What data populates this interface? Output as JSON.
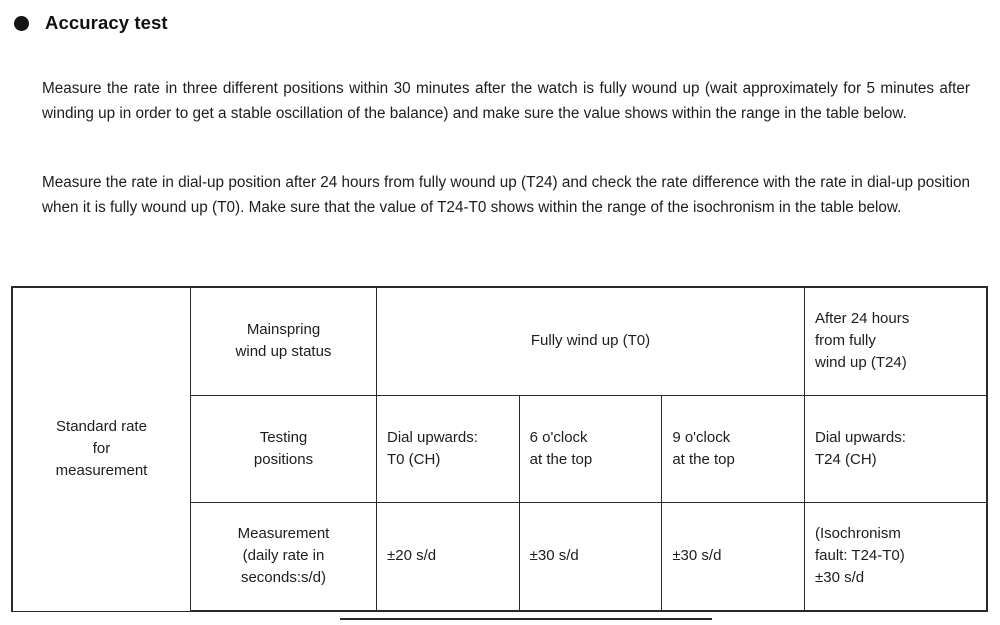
{
  "section": {
    "bullet_icon": "filled-circle-bullet",
    "heading": "Accuracy test"
  },
  "paragraphs": [
    "Measure the rate in three different positions within 30 minutes after the watch is fully wound up (wait approximately for 5 minutes after winding up in order to get a stable oscillation of the balance) and make sure the value shows within the range in the table below.",
    "Measure the rate in dial-up position after 24 hours from fully wound up (T24) and check the rate difference with the rate in dial-up position when it is fully wound up (T0).  Make sure that the value of T24-T0 shows within the range of the isochronism in the table below."
  ],
  "table": {
    "stub_label": "Standard rate\nfor\nmeasurement",
    "rows": [
      {
        "row_label": "Mainspring\nwind up status",
        "group_fully_wound": "Fully wind up (T0)",
        "group_after_24h": "After 24 hours\nfrom fully\nwind up (T24)"
      },
      {
        "row_label": "Testing\npositions",
        "cells": [
          "Dial upwards:\nT0 (CH)",
          "6 o'clock\nat the top",
          "9 o'clock\nat the top",
          "Dial upwards:\nT24 (CH)"
        ]
      },
      {
        "row_label": "Measurement\n(daily rate in\nseconds:s/d)",
        "cells": [
          "±20 s/d",
          "±30 s/d",
          "±30 s/d",
          "(Isochronism\nfault: T24-T0)\n±30 s/d"
        ]
      }
    ]
  },
  "colors": {
    "text": "#1d1d1d",
    "rule": "#2a2a2a",
    "page_background": "#ffffff"
  }
}
